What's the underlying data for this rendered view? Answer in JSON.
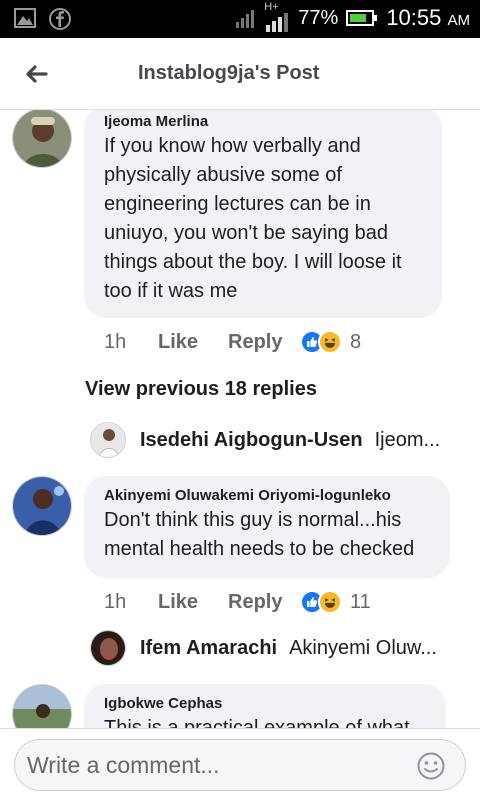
{
  "status_bar": {
    "network_label": "H+",
    "battery_percent": "77%",
    "time": "10:55",
    "ampm": "AM",
    "left_icons": [
      "gallery-icon",
      "facebook-icon"
    ]
  },
  "header": {
    "title": "Instablog9ja's Post"
  },
  "comments": [
    {
      "author": "Ijeoma Merlina",
      "lines": [
        "If you know how verbally and",
        "physically abusive some of",
        "engineering lectures can be in",
        "uniuyo, you won't be saying bad",
        "things about the boy. I will loose it",
        "too if it was me"
      ],
      "time": "1h",
      "like_label": "Like",
      "reply_label": "Reply",
      "reaction_count": "8"
    },
    {
      "author": "Akinyemi Oluwakemi Oriyomi-logunleko",
      "lines": [
        "Don't think this guy is normal...his",
        "mental health needs to be checked"
      ],
      "time": "1h",
      "like_label": "Like",
      "reply_label": "Reply",
      "reaction_count": "11"
    },
    {
      "author": "Igbokwe Cephas",
      "lines": [
        "This is a practical example of what"
      ]
    }
  ],
  "view_previous": "View previous 18 replies",
  "replies": [
    {
      "name": "Isedehi Aigbogun-Usen",
      "snippet": "Ijeom..."
    },
    {
      "name": "Ifem Amarachi",
      "snippet": "Akinyemi Oluw..."
    }
  ],
  "composer": {
    "placeholder": "Write a comment..."
  },
  "colors": {
    "bubble": "#f0f2f5",
    "like_blue": "#1877f2",
    "haha_yellow": "#f7b928",
    "meta_gray": "#65676b"
  }
}
